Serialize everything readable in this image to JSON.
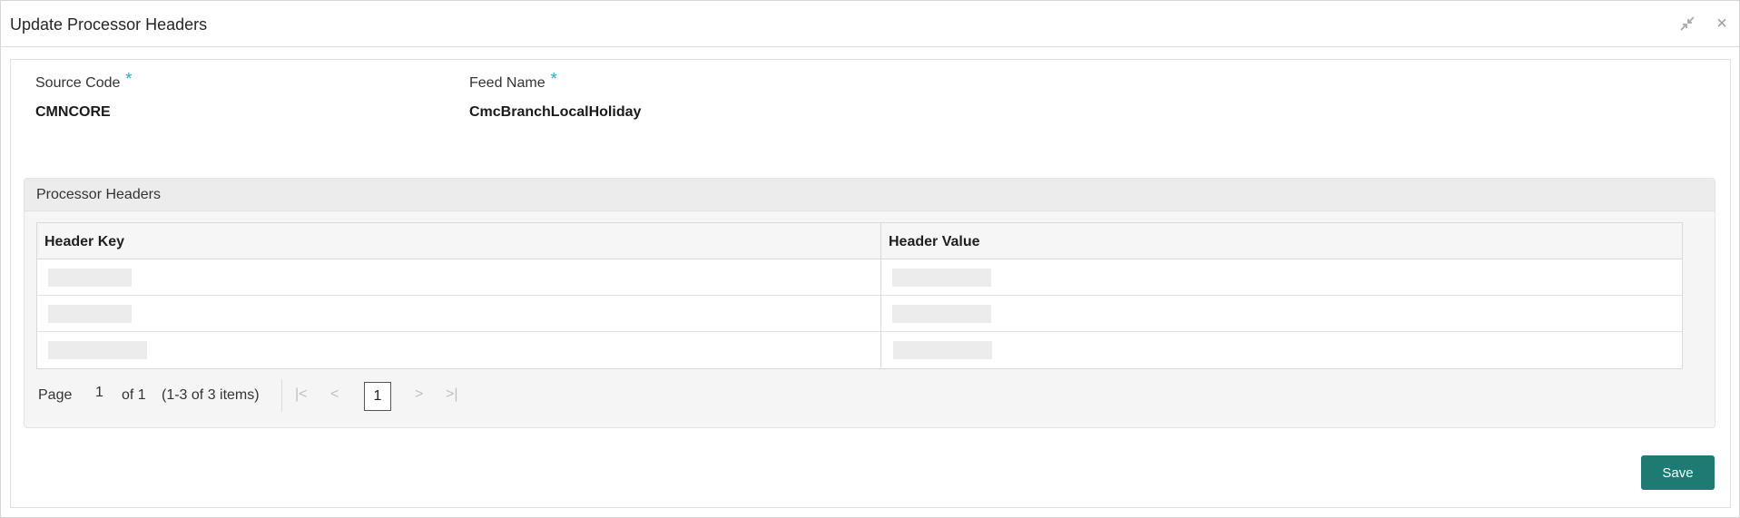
{
  "window": {
    "title": "Update Processor Headers",
    "minimize_icon": "collapse-arrows-icon",
    "close_icon": "close-icon"
  },
  "form": {
    "source_code": {
      "label": "Source Code",
      "required_mark": "*",
      "value": "CMNCORE"
    },
    "feed_name": {
      "label": "Feed Name",
      "required_mark": "*",
      "value": "CmcBranchLocalHoliday"
    }
  },
  "processor_headers": {
    "title": "Processor Headers",
    "columns": [
      "Header Key",
      "Header Value"
    ],
    "row_count": 3
  },
  "pagination": {
    "page_label": "Page",
    "page_input": "1",
    "of_label": "of 1",
    "items_label": "(1-3 of 3 items)",
    "current_page": "1",
    "first_icon": "first-page-icon",
    "prev_icon": "prev-page-icon",
    "next_icon": "next-page-icon",
    "last_icon": "last-page-icon"
  },
  "actions": {
    "save_label": "Save"
  },
  "colors": {
    "accent": "#1e7a73",
    "required": "#2aa7c6"
  }
}
